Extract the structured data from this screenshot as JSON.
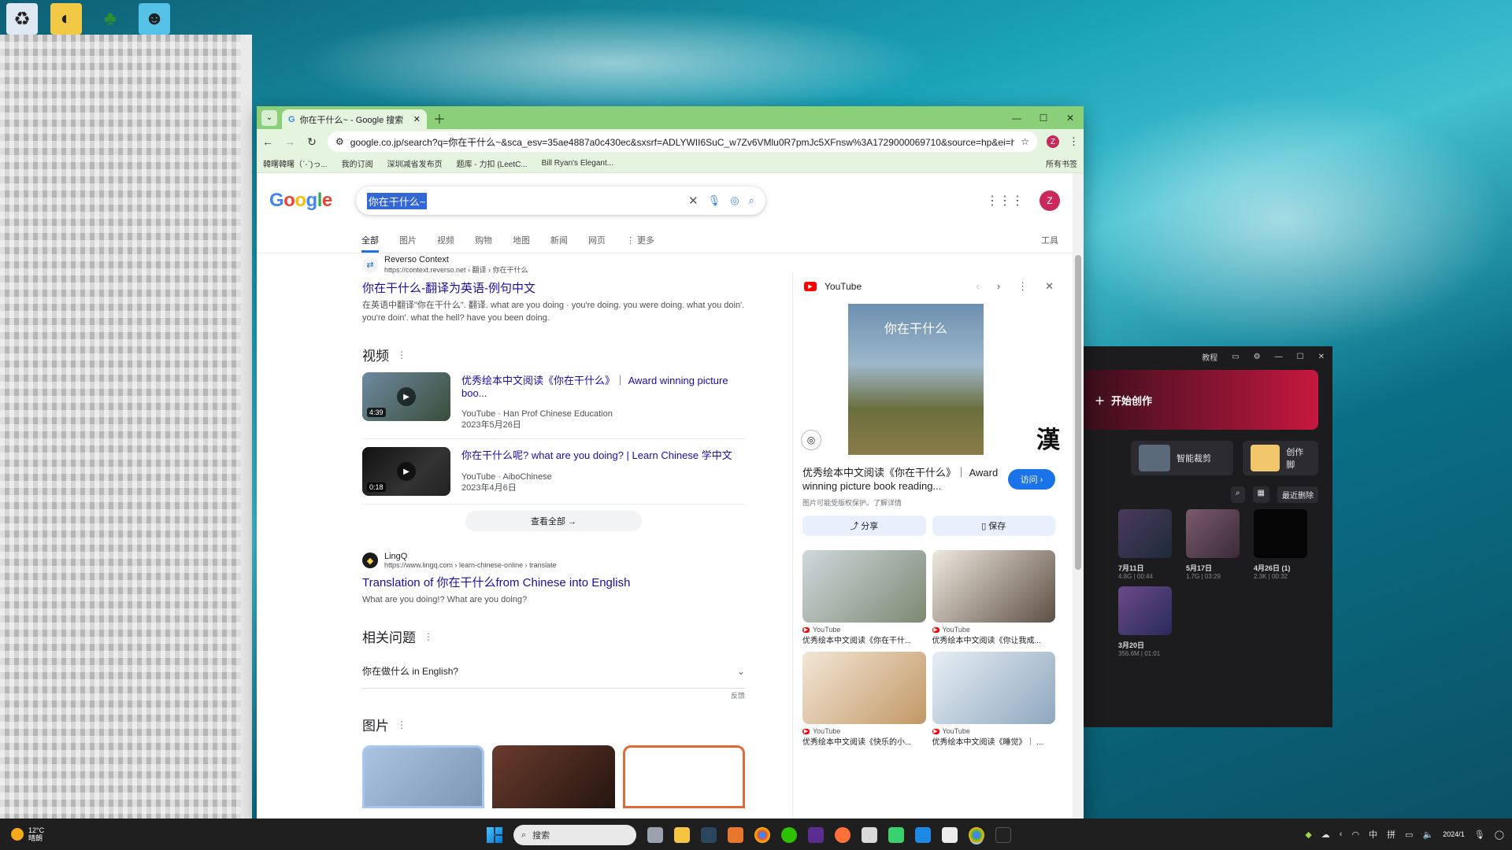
{
  "colors": {
    "chrome_frame": "#8bcf7b",
    "chrome_toolbar": "#e4f4de",
    "link": "#1a0dab",
    "accent": "#1a73e8",
    "editor_bg": "#1c1c1f"
  },
  "desktop": {
    "icons": [
      "recycle-bin-icon",
      "app-icon",
      "tree-icon",
      "character-icon"
    ]
  },
  "browser": {
    "tab_title": "你在干什么~ - Google 搜索",
    "url": "google.co.jp/search?q=你在干什么~&sca_esv=35ae4887a0c430ec&sxsrf=ADLYWII6SuC_w7Zv6VMlu0R7pmJc5XFnsw%3A1729000069710&source=hp&ei=hXIOZ9is...",
    "profile_initial": "Z",
    "bookmarks": [
      "韓曙韓曙（ˊ-ˋ)っ...",
      "我的订阅",
      "深圳减省发布页",
      "题库 - 力扣 (LeetC...",
      "Bill Ryan's Elegant..."
    ],
    "bookmarks_right": "所有书签"
  },
  "google": {
    "logo": "Google",
    "query": "你在干什么~",
    "tabs": [
      "全部",
      "图片",
      "视频",
      "购物",
      "地图",
      "新闻",
      "网页",
      "⋮ 更多"
    ],
    "tools": "工具",
    "result1": {
      "site": "Reverso Context",
      "url": "https://context.reverso.net › 翻译 › 你在干什么",
      "title": "你在干什么-翻译为英语-例句中文",
      "snippet": "在英语中翻译\"你在干什么\". 翻译. what are you doing · you're doing. you were doing. what you doin'. you're doin'. what the hell? have you been doing."
    },
    "videos_heading": "视频",
    "videos": [
      {
        "title": "优秀绘本中文阅读《你在干什么》｜ Award winning picture boo...",
        "channel": "YouTube · Han Prof Chinese Education",
        "date": "2023年5月26日",
        "duration": "4:39"
      },
      {
        "title": "你在干什么呢? what are you doing? | Learn Chinese 学中文",
        "channel": "YouTube · AiboChinese",
        "date": "2023年4月6日",
        "duration": "0:18"
      }
    ],
    "see_all": "查看全部 →",
    "result2": {
      "site": "LingQ",
      "url": "https://www.lingq.com › learn-chinese-online › translate",
      "title": "Translation of 你在干什么from Chinese into English",
      "snippet": "What are you doing!? What are you doing?"
    },
    "related_heading": "相关问题",
    "related_q": "你在做什么 in English?",
    "feedback": "反馈",
    "images_heading": "图片"
  },
  "panel": {
    "source": "YouTube",
    "book_text": "你在干什么",
    "han": "漢",
    "title": "优秀绘本中文阅读《你在干什么》｜ Award winning picture book reading...",
    "visit": "访问 ›",
    "note": "图片可能受版权保护。了解详情",
    "share": "⤴ 分享",
    "save": "▯ 保存",
    "cards": [
      {
        "source": "YouTube",
        "title": "优秀绘本中文阅读《你在干什..."
      },
      {
        "source": "YouTube",
        "title": "优秀绘本中文阅读《你让我成..."
      },
      {
        "source": "YouTube",
        "title": "优秀绘本中文阅读《快乐的小..."
      },
      {
        "source": "YouTube",
        "title": "优秀绘本中文阅读《睡觉》｜ ..."
      }
    ]
  },
  "editor": {
    "tutorial": "教程",
    "create": "开始创作",
    "smart_cut": "智能裁剪",
    "create_script": "创作脚",
    "recent_delete": "最近删除",
    "clips": [
      {
        "date": "7月11日",
        "meta": "4.8G | 00:44"
      },
      {
        "date": "5月17日",
        "meta": "1.7G | 03:29"
      },
      {
        "date": "4月26日 (1)",
        "meta": "2.3K | 00:32"
      },
      {
        "date": "3月20日",
        "meta": "356.6M | 01:01"
      }
    ]
  },
  "taskbar": {
    "temp": "12°C",
    "weather": "晴朗",
    "search_placeholder": "搜索",
    "ime1": "中",
    "ime2": "拼",
    "date": "2024/1"
  }
}
